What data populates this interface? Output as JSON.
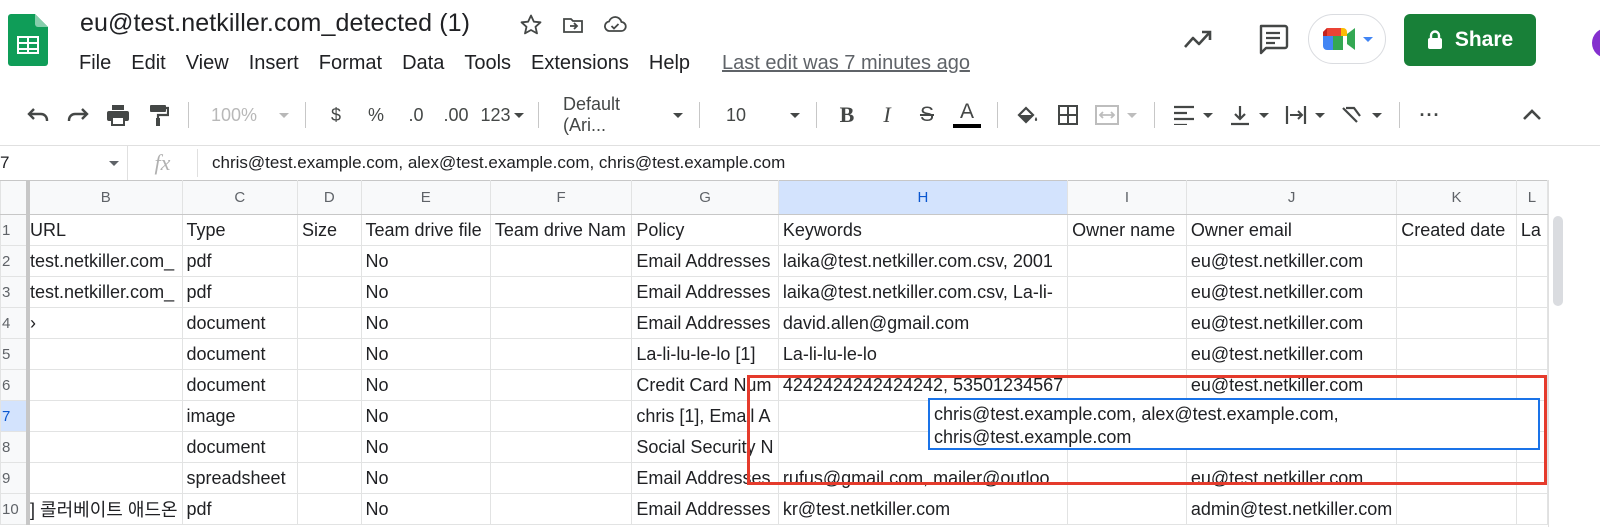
{
  "doc": {
    "title": "eu@test.netkiller.com_detected (1)",
    "last_edit": "Last edit was 7 minutes ago"
  },
  "menu": [
    "File",
    "Edit",
    "View",
    "Insert",
    "Format",
    "Data",
    "Tools",
    "Extensions",
    "Help"
  ],
  "share_label": "Share",
  "toolbar": {
    "zoom": "100%",
    "currency": "$",
    "percent": "%",
    "dec_decrease": ".0",
    "dec_increase": ".00",
    "more_formats": "123",
    "font": "Default (Ari...",
    "font_size": "10",
    "bold": "B",
    "italic": "I",
    "strike": "S",
    "text_color": "A",
    "more": "···"
  },
  "formula_bar": {
    "name_box": "7",
    "fx": "fx",
    "content": "chris@test.example.com, alex@test.example.com, chris@test.example.com"
  },
  "grid": {
    "columns": [
      "B",
      "C",
      "D",
      "E",
      "F",
      "G",
      "H",
      "I",
      "J",
      "K",
      "L"
    ],
    "rows": [
      {
        "n": "1",
        "cells": [
          "URL",
          "Type",
          "Size",
          "Team drive file",
          "Team drive Nam",
          "Policy",
          "Keywords",
          "Owner name",
          "Owner email",
          "Created date",
          "La"
        ]
      },
      {
        "n": "2",
        "cells": [
          "test.netkiller.com_",
          "pdf",
          "",
          "No",
          "",
          "Email Addresses",
          "laika@test.netkiller.com.csv, 2001",
          "",
          "eu@test.netkiller.com",
          "",
          ""
        ]
      },
      {
        "n": "3",
        "cells": [
          "test.netkiller.com_",
          "pdf",
          "",
          "No",
          "",
          "Email Addresses",
          "laika@test.netkiller.com.csv, La-li-",
          "",
          "eu@test.netkiller.com",
          "",
          ""
        ]
      },
      {
        "n": "4",
        "cells": [
          "›",
          "document",
          "",
          "No",
          "",
          "Email Addresses",
          "david.allen@gmail.com",
          "",
          "eu@test.netkiller.com",
          "",
          ""
        ]
      },
      {
        "n": "5",
        "cells": [
          "",
          "document",
          "",
          "No",
          "",
          "La-li-lu-le-lo [1]",
          "La-li-lu-le-lo",
          "",
          "eu@test.netkiller.com",
          "",
          ""
        ]
      },
      {
        "n": "6",
        "cells": [
          "",
          "document",
          "",
          "No",
          "",
          "Credit Card Num",
          "4242424242424242, 53501234567",
          "",
          "eu@test.netkiller.com",
          "",
          ""
        ]
      },
      {
        "n": "7",
        "cells": [
          "",
          "image",
          "",
          "No",
          "",
          "chris [1], Email A",
          "",
          "",
          "",
          "",
          ""
        ]
      },
      {
        "n": "8",
        "cells": [
          "",
          "document",
          "",
          "No",
          "",
          "Social Security N",
          "",
          "",
          "",
          "",
          ""
        ]
      },
      {
        "n": "9",
        "cells": [
          "",
          "spreadsheet",
          "",
          "No",
          "",
          "Email Addresses",
          "rufus@gmail.com, mailer@outloo",
          "",
          "eu@test.netkiller.com",
          "",
          ""
        ]
      },
      {
        "n": "10",
        "cells": [
          "] 콜러베이트 애드온",
          "pdf",
          "",
          "No",
          "",
          "Email Addresses",
          "kr@test.netkiller.com",
          "",
          "admin@test.netkiller.com",
          "",
          ""
        ]
      }
    ],
    "active_cell_content": "chris@test.example.com, alex@test.example.com,\nchris@test.example.com"
  },
  "colors": {
    "share_green": "#188038",
    "selection_blue": "#1a73e8",
    "highlight_red": "#e53b2c",
    "sheets_green": "#0f9d58"
  }
}
